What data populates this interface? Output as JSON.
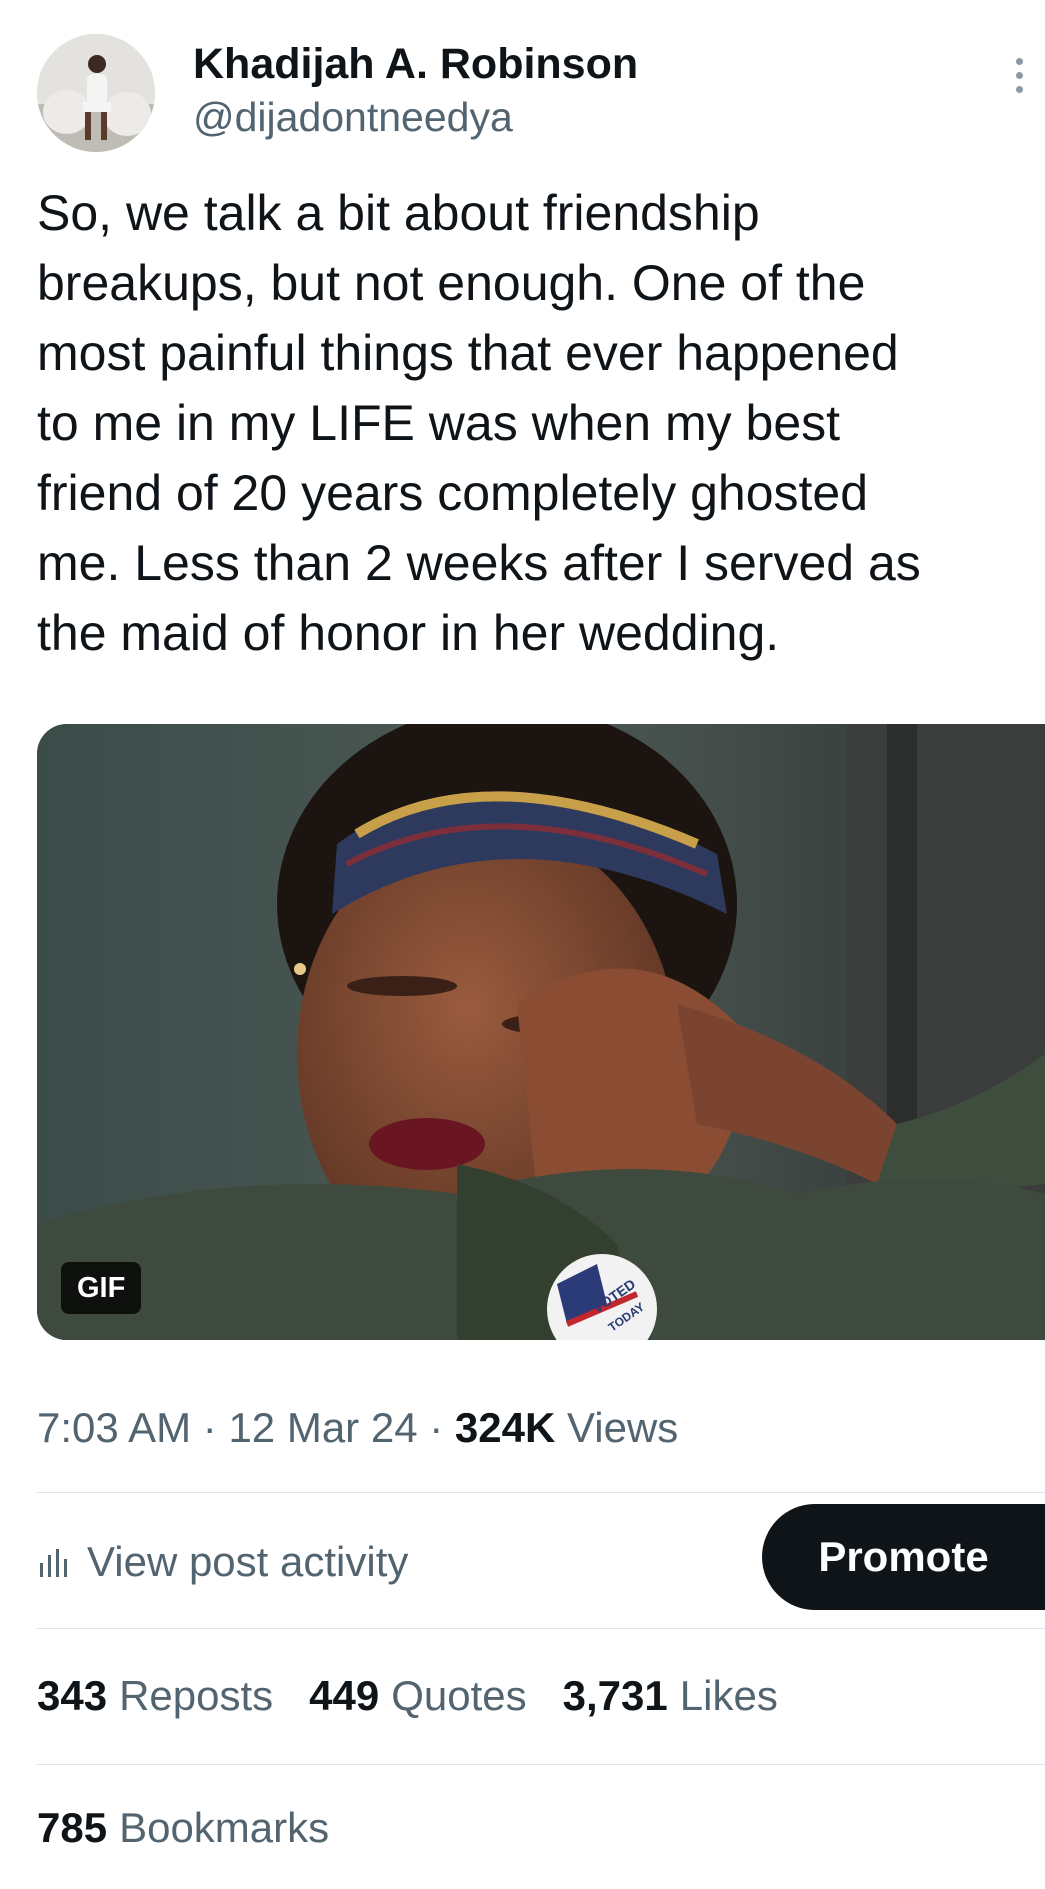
{
  "author": {
    "display_name": "Khadijah A. Robinson",
    "handle": "@dijadontneedya",
    "avatar_icon": "profile-photo"
  },
  "more_icon": "more-vertical-icon",
  "tweet": {
    "text_lines": [
      "So, we talk a bit about friendship",
      "breakups, but not enough. One of the",
      "most painful things that ever happened",
      "to me in my LIFE was when my best",
      "friend of 20 years completely ghosted",
      "me. Less than 2 weeks after I served as",
      "the maid of honor in her wedding."
    ]
  },
  "media": {
    "badge": "GIF",
    "pin_text_1": "VOTED",
    "pin_text_2": "TODAY"
  },
  "meta": {
    "time": "7:03 AM",
    "separator": "·",
    "date": "12 Mar 24",
    "views_count": "324K",
    "views_label": "Views"
  },
  "actions": {
    "activity_label": "View post activity",
    "activity_icon": "analytics-icon",
    "promote_label": "Promote"
  },
  "stats": {
    "reposts_count": "343",
    "reposts_label": "Reposts",
    "quotes_count": "449",
    "quotes_label": "Quotes",
    "likes_count": "3,731",
    "likes_label": "Likes",
    "bookmarks_count": "785",
    "bookmarks_label": "Bookmarks"
  },
  "colors": {
    "text_primary": "#0f1419",
    "text_secondary": "#536471",
    "divider": "#dfe4e8",
    "button_bg": "#0f1419"
  }
}
